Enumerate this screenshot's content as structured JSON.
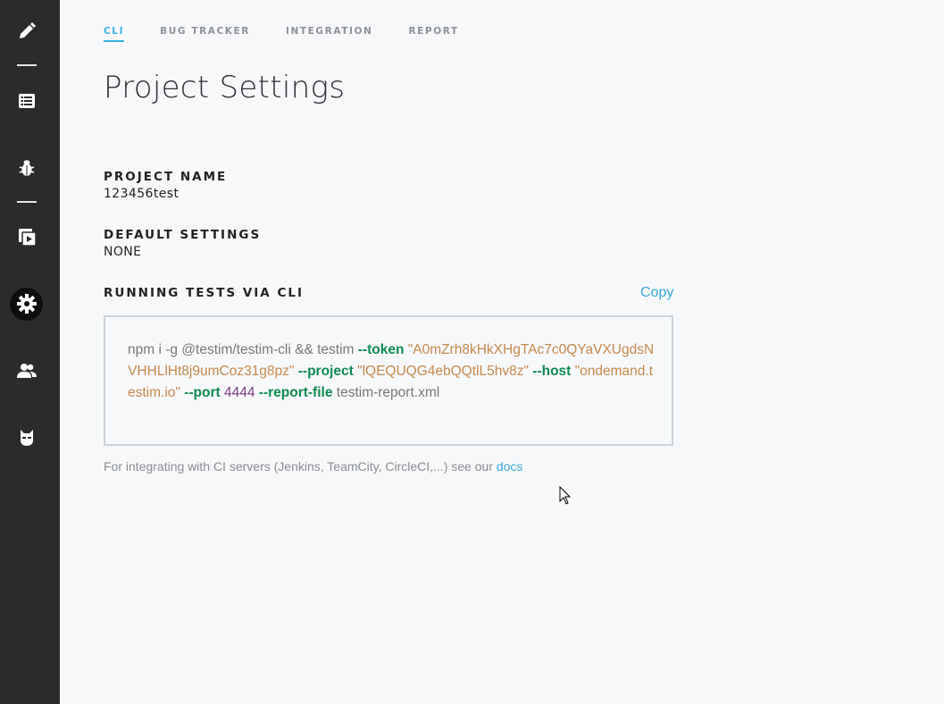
{
  "sidebar": {
    "items": [
      {
        "icon": "pencil-icon"
      },
      {
        "icon": "list-icon"
      },
      {
        "icon": "bug-icon"
      },
      {
        "icon": "play-icon"
      },
      {
        "icon": "gear-icon",
        "active": true
      },
      {
        "icon": "users-icon"
      },
      {
        "icon": "mask-icon"
      }
    ]
  },
  "tabs": [
    {
      "label": "CLI",
      "active": true
    },
    {
      "label": "BUG TRACKER"
    },
    {
      "label": "INTEGRATION"
    },
    {
      "label": "REPORT"
    }
  ],
  "page": {
    "title": "Project Settings"
  },
  "project_name": {
    "label": "PROJECT NAME",
    "value": "123456test"
  },
  "default_settings": {
    "label": "DEFAULT SETTINGS",
    "value": "NONE"
  },
  "cli": {
    "label": "RUNNING TESTS VIA CLI",
    "copy_label": "Copy",
    "command": {
      "install": "npm i -g @testim/testim-cli && testim ",
      "token_flag": "--token",
      "token_value": "\"A0mZrh8kHkXHgTAc7c0QYaVXUgdsNVHHLlHt8j9umCoz31g8pz\"",
      "project_flag": "--project",
      "project_value": "\"lQEQUQG4ebQQtlL5hv8z\"",
      "host_flag": "--host",
      "host_value": "\"ondemand.testim.io\"",
      "port_flag": "--port",
      "port_value": "4444",
      "report_flag": "--report-file",
      "report_value": "testim-report.xml"
    },
    "helper_text": "For integrating with CI servers (Jenkins, TeamCity, CircleCI,...) see our ",
    "helper_link": "docs"
  },
  "colors": {
    "sidebar_bg": "#2b2b2b",
    "accent": "#39b2e0",
    "keyword": "#0f8a52",
    "string": "#c48a4d",
    "number": "#7a3c80"
  }
}
